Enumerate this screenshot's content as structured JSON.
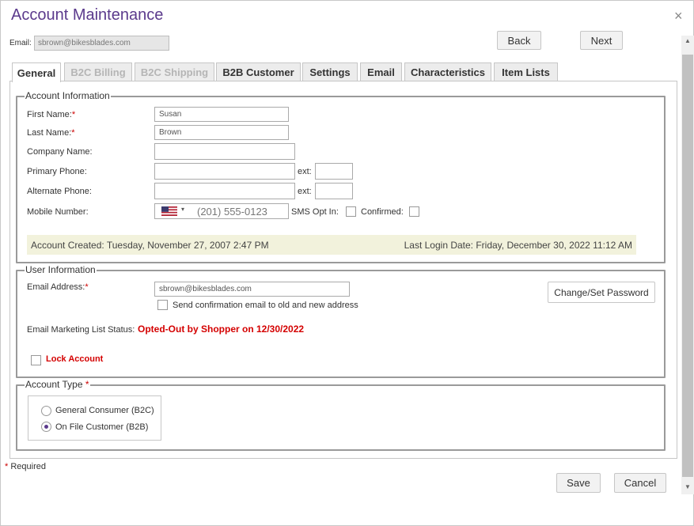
{
  "window": {
    "title": "Account Maintenance",
    "close_glyph": "×"
  },
  "top": {
    "email_label": "Email:",
    "email_value": "sbrown@bikesblades.com",
    "back_label": "Back",
    "next_label": "Next"
  },
  "tabs": [
    {
      "label": "General",
      "state": "active"
    },
    {
      "label": "B2C Billing",
      "state": "disabled"
    },
    {
      "label": "B2C Shipping",
      "state": "disabled"
    },
    {
      "label": "B2B Customer",
      "state": "enabled"
    },
    {
      "label": "Settings",
      "state": "enabled"
    },
    {
      "label": "Email",
      "state": "enabled"
    },
    {
      "label": "Characteristics",
      "state": "enabled"
    },
    {
      "label": "Item Lists",
      "state": "enabled"
    }
  ],
  "account_info": {
    "legend": "Account Information",
    "first_name_label": "First Name:",
    "first_name_value": "Susan",
    "last_name_label": "Last Name:",
    "last_name_value": "Brown",
    "company_label": "Company Name:",
    "company_value": "",
    "primary_phone_label": "Primary Phone:",
    "primary_phone_value": "",
    "alternate_phone_label": "Alternate Phone:",
    "alternate_phone_value": "",
    "ext_label": "ext:",
    "mobile_label": "Mobile Number:",
    "mobile_placeholder": "(201) 555-0123",
    "mobile_caret": "▾",
    "sms_opt_in_label": "SMS Opt In:",
    "confirmed_label": "Confirmed:",
    "account_created": "Account Created: Tuesday, November 27, 2007 2:47 PM",
    "last_login": "Last Login Date: Friday, December 30, 2022 11:12 AM"
  },
  "user_info": {
    "legend": "User Information",
    "email_label": "Email Address:",
    "email_value": "sbrown@bikesblades.com",
    "send_confirmation_label": "Send confirmation email to old and new address",
    "change_password_label": "Change/Set Password",
    "marketing_status_label": "Email Marketing List Status:",
    "marketing_status_value": "Opted-Out by Shopper on 12/30/2022",
    "lock_account_label": "Lock Account"
  },
  "account_type": {
    "legend": "Account Type",
    "options": [
      {
        "label": "General Consumer (B2C)",
        "checked": false
      },
      {
        "label": "On File Customer (B2B)",
        "checked": true
      }
    ]
  },
  "footer": {
    "required_mark": "*",
    "required_text": "Required",
    "save_label": "Save",
    "cancel_label": "Cancel"
  },
  "required_star": "*",
  "scrollbar": {
    "up_glyph": "▲",
    "down_glyph": "▼"
  },
  "colors": {
    "title": "#5b3a8c",
    "required": "#cc0000",
    "alert": "#d40000",
    "info_bar": "#f2f2dc"
  }
}
